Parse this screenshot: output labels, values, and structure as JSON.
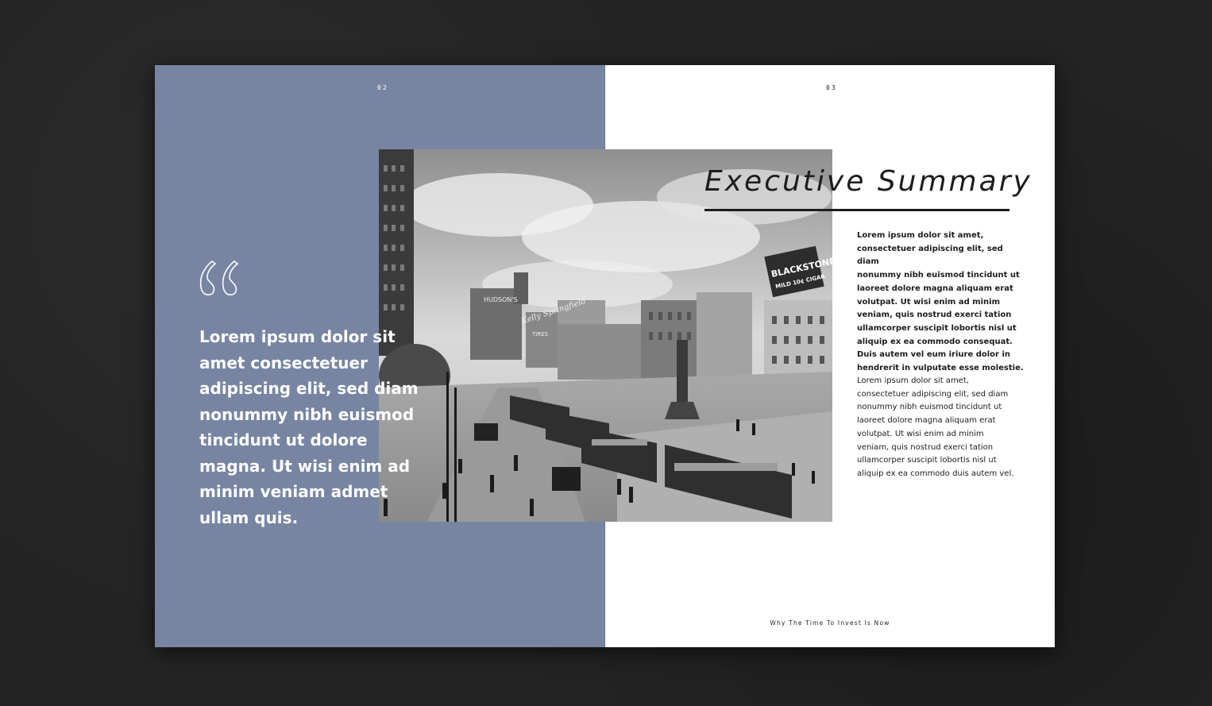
{
  "spread": {
    "left_page_number": "02",
    "right_page_number": "03",
    "accent_color": "#7785a3"
  },
  "pull_quote": {
    "icon": "quotation-mark-icon",
    "text": "Lorem ipsum dolor sit\namet consectetuer\nadipiscing elit, sed diam\nnonummy nibh euismod\ntincidunt ut dolore\nmagna. Ut wisi enim ad\nminim veniam admet\nullam quis."
  },
  "photo": {
    "signs": [
      "HUDSON'S",
      "Kelly Springfield",
      "TIRES",
      "BLACKSTONE",
      "MILD 10¢ CIGAR"
    ]
  },
  "summary": {
    "title": "Executive Summary",
    "paragraph_1": "Lorem ipsum dolor sit amet,\nconsectetuer adipiscing elit, sed diam\nnonummy nibh euismod tincidunt ut\nlaoreet dolore magna aliquam erat\nvolutpat. Ut wisi enim ad minim\nveniam, quis nostrud exerci tation\nullamcorper suscipit lobortis nisl ut\naliquip ex ea commodo consequat.\nDuis autem vel eum iriure dolor in\nhendrerit in vulputate esse molestie.",
    "paragraph_2": "Lorem ipsum dolor sit amet,\nconsectetuer adipiscing elit, sed diam\nnonummy nibh euismod tincidunt ut\nlaoreet dolore magna aliquam erat\nvolutpat. Ut wisi enim ad minim\nveniam, quis nostrud exerci tation\nullamcorper suscipit lobortis nisl ut\naliquip ex ea commodo duis autem vel."
  },
  "footer": {
    "text": "Why The Time To Invest Is Now"
  }
}
